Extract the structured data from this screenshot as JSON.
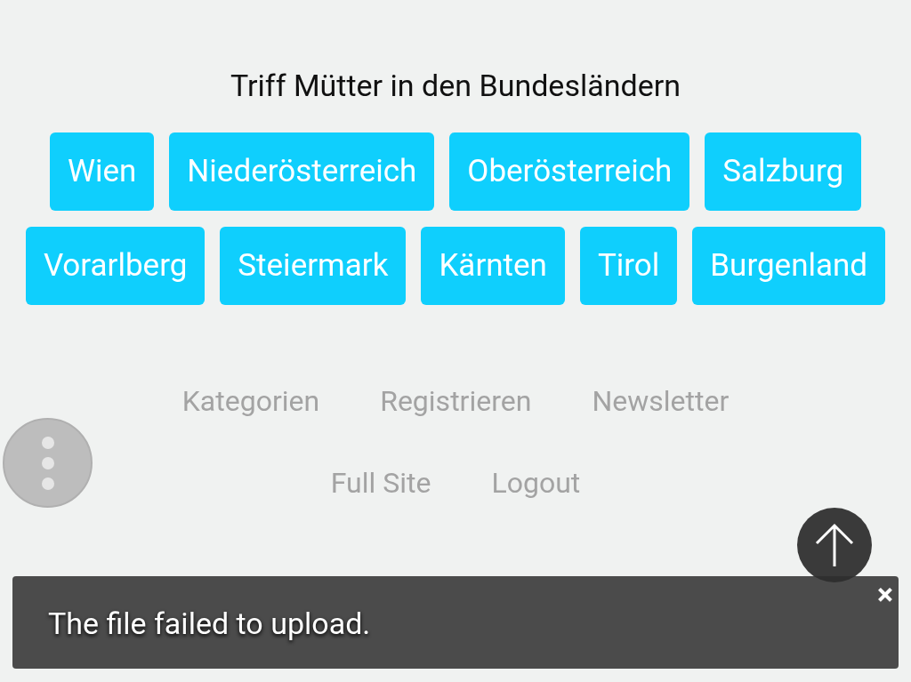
{
  "title": "Triff Mütter in den Bundesländern",
  "regions": [
    "Wien",
    "Niederösterreich",
    "Oberösterreich",
    "Salzburg",
    "Vorarlberg",
    "Steiermark",
    "Kärnten",
    "Tirol",
    "Burgenland"
  ],
  "footer_links": [
    [
      "Kategorien",
      "Registrieren",
      "Newsletter"
    ],
    [
      "Full Site",
      "Logout"
    ]
  ],
  "toast": {
    "message": "The file failed to upload.",
    "close": "×"
  }
}
